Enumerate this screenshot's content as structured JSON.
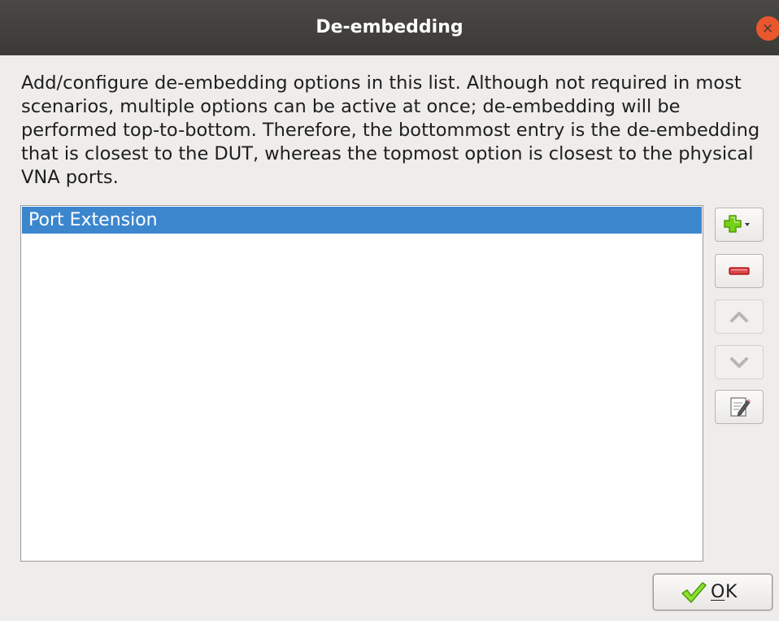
{
  "window": {
    "title": "De-embedding",
    "close_glyph": "×"
  },
  "description": "Add/configure de-embedding options in this list. Although not required in most scenarios, multiple options can be active at once; de-embedding will be performed top-to-bottom. Therefore, the bottommost entry is the de-embedding that is closest to the DUT, whereas the topmost option is closest to the physical VNA ports.",
  "list": {
    "items": [
      {
        "label": "Port Extension",
        "selected": true
      }
    ]
  },
  "side_buttons": [
    {
      "name": "add-button",
      "icon": "plus-icon",
      "enabled": true
    },
    {
      "name": "remove-button",
      "icon": "minus-icon",
      "enabled": true
    },
    {
      "name": "move-up-button",
      "icon": "chevron-up-icon",
      "enabled": false
    },
    {
      "name": "move-down-button",
      "icon": "chevron-down-icon",
      "enabled": false
    },
    {
      "name": "edit-button",
      "icon": "edit-icon",
      "enabled": true
    }
  ],
  "ok_button": {
    "mnemonic": "O",
    "rest": "K",
    "icon": "checkmark-icon"
  },
  "colors": {
    "titlebar": "#3b3a36",
    "selection": "#3c86ce",
    "close": "#e9572d",
    "add_green": "#73d216",
    "remove_red": "#d9464b"
  }
}
